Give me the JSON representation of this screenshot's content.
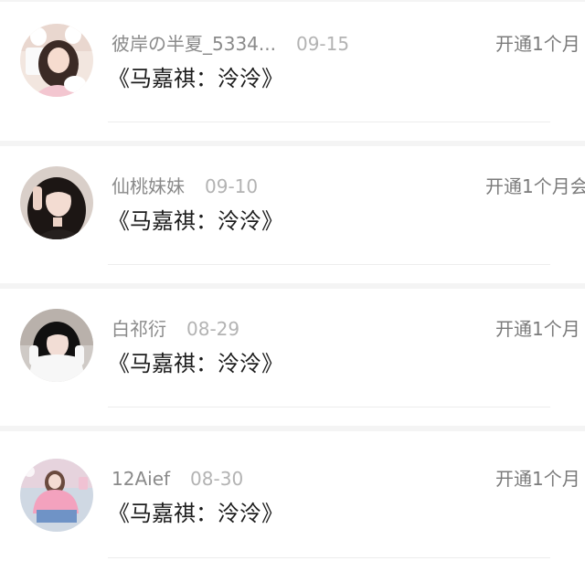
{
  "comments": [
    {
      "username": "彼岸の半夏_5334...",
      "date": "09-15",
      "content": "《马嘉祺：泠泠》",
      "badge": "开通1个月"
    },
    {
      "username": "仙桃妹妹",
      "date": "09-10",
      "content": "《马嘉祺：泠泠》",
      "badge": "开通1个月会"
    },
    {
      "username": "白祁衍",
      "date": "08-29",
      "content": "《马嘉祺：泠泠》",
      "badge": "开通1个月"
    },
    {
      "username": "12Aief",
      "date": "08-30",
      "content": "《马嘉祺：泠泠》",
      "badge": "开通1个月"
    }
  ]
}
